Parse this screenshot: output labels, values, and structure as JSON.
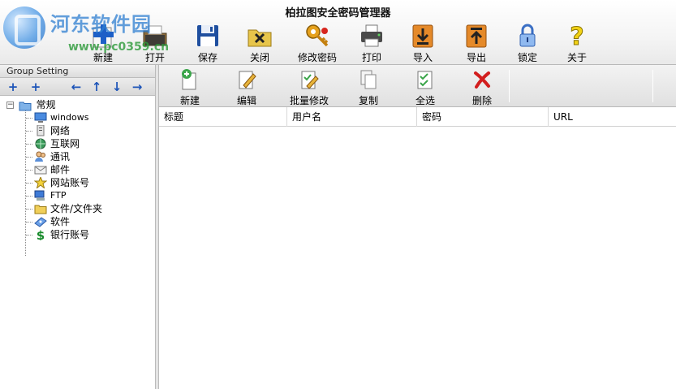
{
  "window": {
    "title": "柏拉图安全密码管理器"
  },
  "watermark": {
    "title": "河东软件园",
    "url": "www.pc0359.cn"
  },
  "main_toolbar": [
    {
      "label": "新建",
      "icon": "new-plus-icon"
    },
    {
      "label": "打开",
      "icon": "open-folder-icon"
    },
    {
      "label": "保存",
      "icon": "save-disk-icon"
    },
    {
      "label": "关闭",
      "icon": "close-folder-icon"
    },
    {
      "label": "修改密码",
      "icon": "key-icon"
    },
    {
      "label": "打印",
      "icon": "printer-icon"
    },
    {
      "label": "导入",
      "icon": "import-icon"
    },
    {
      "label": "导出",
      "icon": "export-icon"
    },
    {
      "label": "锁定",
      "icon": "padlock-icon"
    },
    {
      "label": "关于",
      "icon": "question-icon"
    }
  ],
  "left_panel": {
    "header": "Group Setting",
    "root": {
      "label": "常规",
      "expander": "−"
    },
    "items": [
      {
        "label": "windows",
        "icon": "monitor-icon"
      },
      {
        "label": "网络",
        "icon": "network-tower-icon"
      },
      {
        "label": "互联网",
        "icon": "globe-icon"
      },
      {
        "label": "通讯",
        "icon": "contacts-icon"
      },
      {
        "label": "邮件",
        "icon": "mail-icon"
      },
      {
        "label": "网站账号",
        "icon": "star-icon"
      },
      {
        "label": "FTP",
        "icon": "ftp-computer-icon"
      },
      {
        "label": "文件/文件夹",
        "icon": "folder-icon"
      },
      {
        "label": "软件",
        "icon": "software-cd-icon"
      },
      {
        "label": "银行账号",
        "icon": "dollar-icon"
      }
    ]
  },
  "sub_toolbar": [
    {
      "label": "新建",
      "icon": "new-doc-icon"
    },
    {
      "label": "编辑",
      "icon": "edit-doc-icon"
    },
    {
      "label": "批量修改",
      "icon": "batch-edit-icon"
    },
    {
      "label": "复制",
      "icon": "copy-icon"
    },
    {
      "label": "全选",
      "icon": "select-all-icon"
    },
    {
      "label": "删除",
      "icon": "delete-x-icon"
    }
  ],
  "grid": {
    "columns": [
      "标题",
      "用户名",
      "密码",
      "URL"
    ]
  },
  "colors": {
    "accent_blue": "#1c54b8",
    "toolbar_bg": "#ececec"
  }
}
